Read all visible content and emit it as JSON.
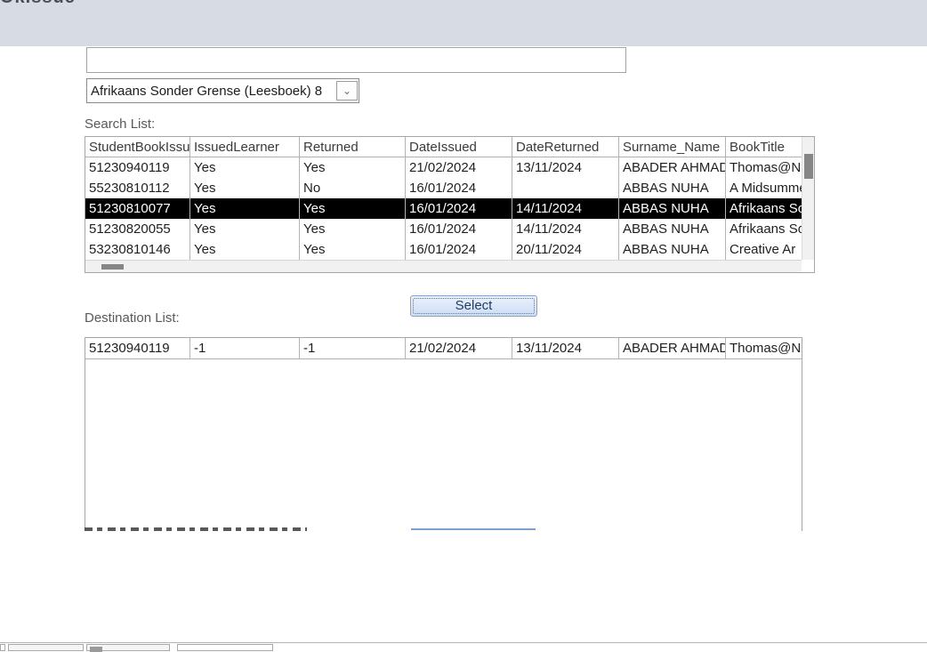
{
  "header": {
    "title_fragment": "OkIssue"
  },
  "filter": {
    "search_input_value": "",
    "book_combo_value": "Afrikaans Sonder Grense (Leesboek) 8",
    "combo_arrow_icon": "⌄"
  },
  "search_list": {
    "label": "Search List:",
    "columns": [
      "StudentBookIssue",
      "IssuedLearner",
      "Returned",
      "DateIssued",
      "DateReturned",
      "Surname_Name",
      "BookTitle"
    ],
    "rows": [
      [
        "51230940119",
        "Yes",
        "Yes",
        "21/02/2024",
        "13/11/2024",
        "ABADER AHMAD",
        "Thomas@N"
      ],
      [
        "55230810112",
        "Yes",
        "No",
        "16/01/2024",
        "",
        "ABBAS NUHA",
        "A Midsummer"
      ],
      [
        "51230810077",
        "Yes",
        "Yes",
        "16/01/2024",
        "14/11/2024",
        "ABBAS NUHA",
        "Afrikaans So"
      ],
      [
        "51230820055",
        "Yes",
        "Yes",
        "16/01/2024",
        "14/11/2024",
        "ABBAS NUHA",
        "Afrikaans So"
      ],
      [
        "53230810146",
        "Yes",
        "Yes",
        "16/01/2024",
        "20/11/2024",
        "ABBAS NUHA",
        "Creative Ar"
      ]
    ],
    "selected_row_index": 2
  },
  "select_button": {
    "label": "Select"
  },
  "destination_list": {
    "label": "Destination List:",
    "rows": [
      [
        "51230940119",
        "-1",
        "-1",
        "21/02/2024",
        "13/11/2024",
        "ABADER AHMAD",
        "Thomas@N"
      ]
    ]
  },
  "colors": {
    "header_band": "#d7dce4",
    "selected_row_bg": "#000000",
    "selected_row_text": "#ffffff",
    "button_face": "#cdddf6",
    "button_border": "#87a3cc"
  }
}
